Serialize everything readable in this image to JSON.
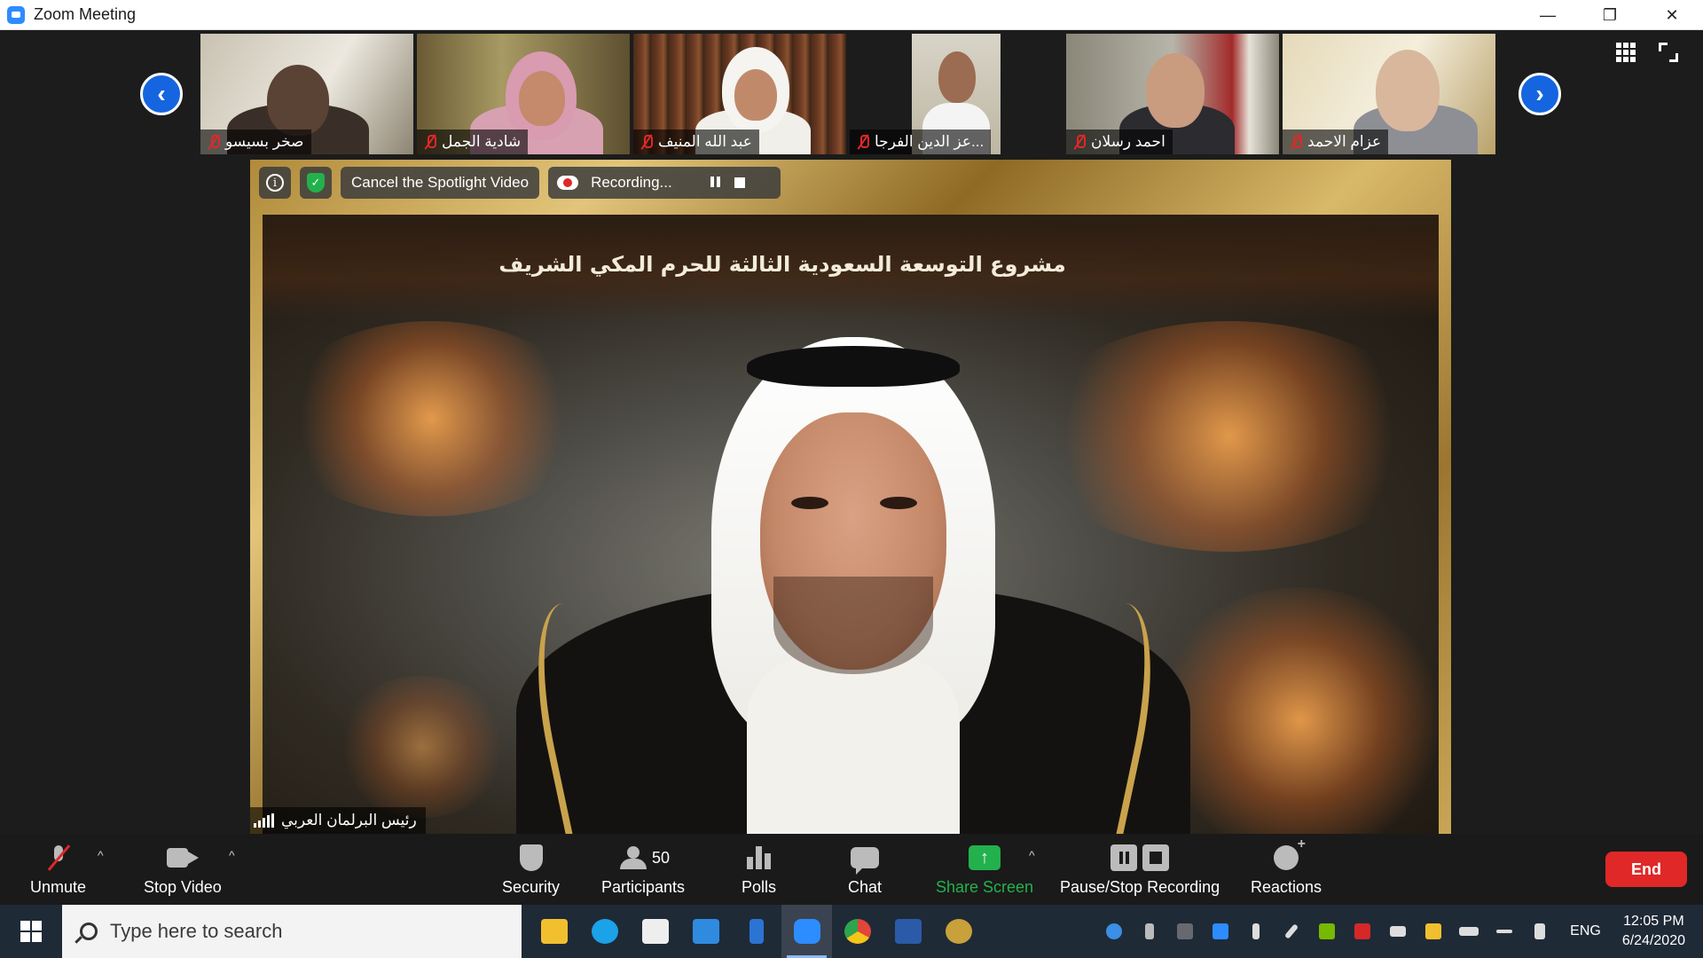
{
  "window": {
    "title": "Zoom Meeting",
    "minimize": "—",
    "restore": "❐",
    "close": "✕"
  },
  "gallery": {
    "prev_arrow": "‹",
    "next_arrow": "›",
    "participants": [
      {
        "name": "صخر بسيسو",
        "muted": true
      },
      {
        "name": "شادية الجمل",
        "muted": true
      },
      {
        "name": "عبد الله المنيف",
        "muted": true
      },
      {
        "name": "عز الدين الفرجا...",
        "muted": true
      },
      {
        "name": "احمد رسلان",
        "muted": true
      },
      {
        "name": "عزام الاحمد",
        "muted": true
      }
    ]
  },
  "spotlight": {
    "info_icon": "i",
    "shield_icon": "✓",
    "cancel_label": "Cancel the Spotlight Video",
    "recording_label": "Recording...",
    "painting_text": "مشروع التوسعة السعودية الثالثة للحرم المكي الشريف",
    "speaker_name": "رئيس البرلمان العربي"
  },
  "controls": {
    "unmute": "Unmute",
    "stop_video": "Stop Video",
    "security": "Security",
    "participants": "Participants",
    "participants_count": "50",
    "polls": "Polls",
    "chat": "Chat",
    "share_screen": "Share Screen",
    "share_arrow": "↑",
    "pause_stop_recording": "Pause/Stop Recording",
    "reactions": "Reactions",
    "end": "End",
    "caret": "^"
  },
  "taskbar": {
    "search_placeholder": "Type here to search",
    "language": "ENG",
    "time": "12:05 PM",
    "date": "6/24/2020",
    "apps": [
      {
        "name": "file-explorer-icon",
        "color": "#f2c02e"
      },
      {
        "name": "edge-icon",
        "color": "#1ba2e8"
      },
      {
        "name": "store-icon",
        "color": "#eeeeee"
      },
      {
        "name": "mail-icon",
        "color": "#2f8be0"
      },
      {
        "name": "power-automate-icon",
        "color": "#2c74d3"
      },
      {
        "name": "zoom-icon",
        "color": "#2d8cff"
      },
      {
        "name": "chrome-icon",
        "color": "#e0463a"
      },
      {
        "name": "word-icon",
        "color": "#2b5aa8"
      },
      {
        "name": "paint-icon",
        "color": "#c9a13a"
      }
    ]
  }
}
